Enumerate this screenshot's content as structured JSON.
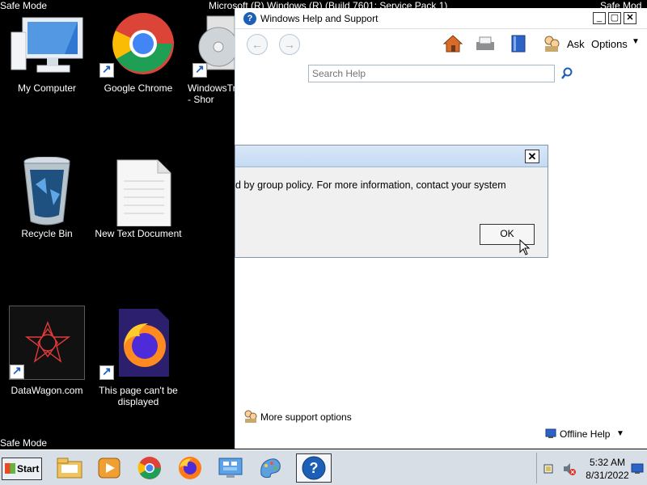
{
  "desktop": {
    "safe_mode_label": "Safe Mode",
    "background_title_fragment": "Microsoft (R) Windows (R) (Build 7601: Service Pack 1)",
    "safe_mode_right": "Safe Mod",
    "icons": [
      {
        "label": "My Computer",
        "icon": "computer-icon"
      },
      {
        "label": "Google Chrome",
        "icon": "chrome-icon"
      },
      {
        "label": "WindowsTr - Shor",
        "icon": "disc-icon"
      },
      {
        "label": "Recycle Bin",
        "icon": "recycle-bin-icon"
      },
      {
        "label": "New Text Document",
        "icon": "text-document-icon"
      },
      {
        "label": "DataWagon.com",
        "icon": "datawagon-icon"
      },
      {
        "label": "This page can't be displayed",
        "icon": "firefox-icon"
      }
    ]
  },
  "help_window": {
    "title": "Windows Help and Support",
    "ask_label": "Ask",
    "options_label": "Options",
    "search_placeholder": "Search Help",
    "more_support": "More support options",
    "offline_help": "Offline Help"
  },
  "dialog": {
    "message": "d by group policy. For more information, contact your system",
    "ok_label": "OK"
  },
  "taskbar": {
    "start_label": "Start",
    "time": "5:32 AM",
    "date": "8/31/2022"
  }
}
